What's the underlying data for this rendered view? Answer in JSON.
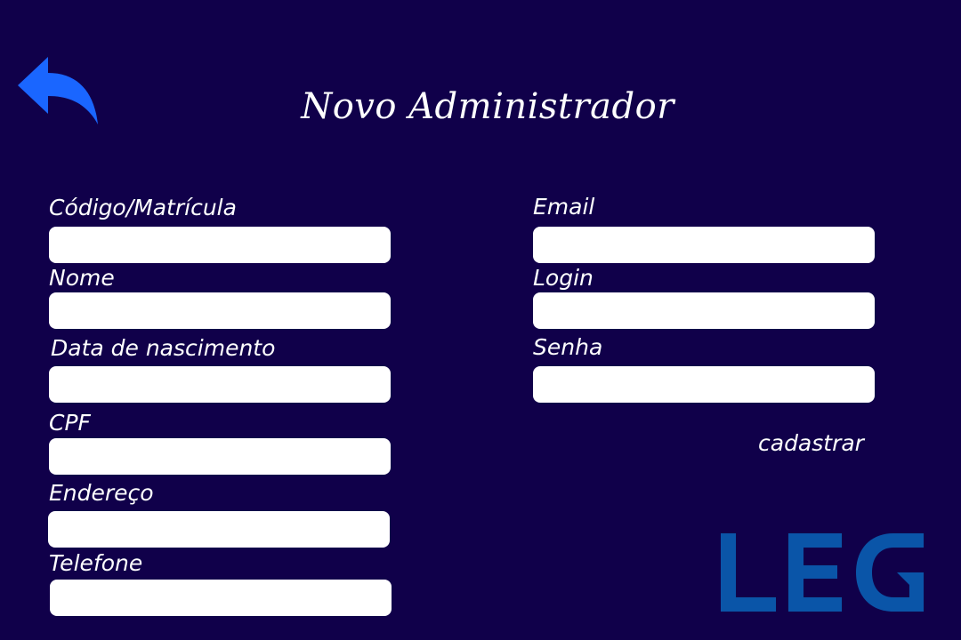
{
  "header": {
    "title": "Novo Administrador",
    "back_icon": "undo-arrow-icon"
  },
  "form": {
    "left_fields": [
      {
        "label": "Código/Matrícula",
        "value": "",
        "placeholder": ""
      },
      {
        "label": "Nome",
        "value": "",
        "placeholder": ""
      },
      {
        "label": "Data de nascimento",
        "value": "",
        "placeholder": ""
      },
      {
        "label": "CPF",
        "value": "",
        "placeholder": ""
      },
      {
        "label": "Endereço",
        "value": "",
        "placeholder": ""
      },
      {
        "label": "Telefone",
        "value": "",
        "placeholder": ""
      }
    ],
    "right_fields": [
      {
        "label": "Email",
        "value": "",
        "placeholder": ""
      },
      {
        "label": "Login",
        "value": "",
        "placeholder": ""
      },
      {
        "label": "Senha",
        "value": "",
        "placeholder": ""
      }
    ],
    "submit_label": "cadastrar"
  },
  "logo": {
    "text": "LEG"
  },
  "colors": {
    "background": "#10004a",
    "field": "#ffffff",
    "text": "#ffffff",
    "back_icon": "#1a66ff",
    "logo": "#0a55a8"
  }
}
